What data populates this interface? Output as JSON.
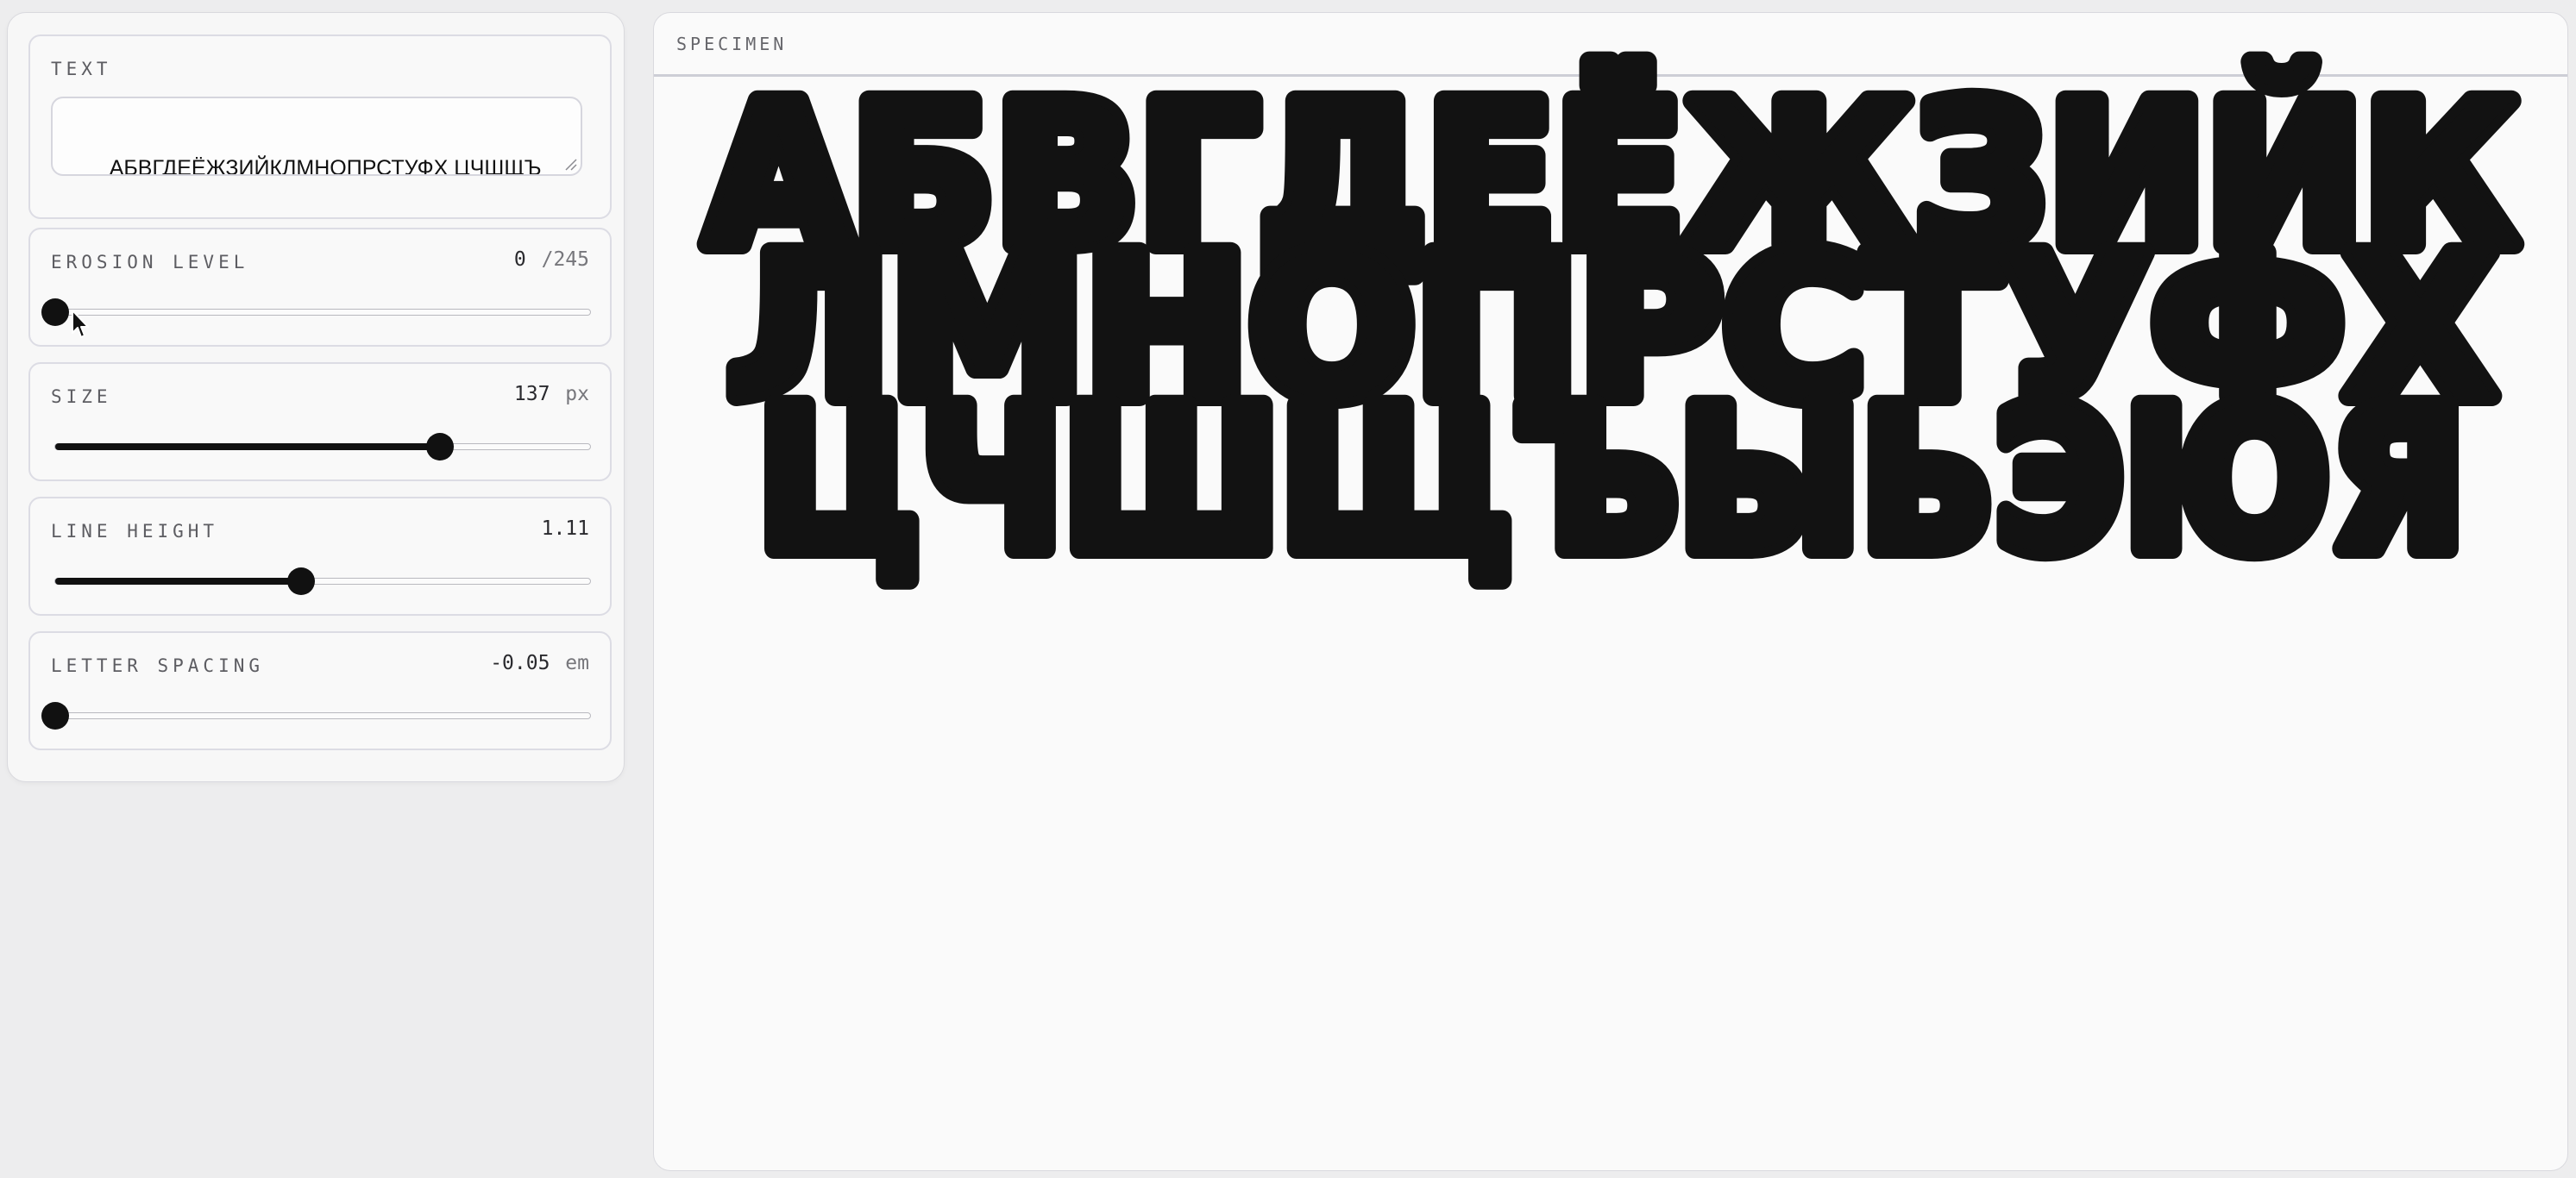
{
  "controls": {
    "text": {
      "label": "TEXT",
      "value": "АБВГДЕЁЖЗИЙКЛМНОПРСТУФХ ЦЧШЩЪЫЬЭЮЯ"
    },
    "erosion": {
      "label": "EROSION LEVEL",
      "value": "0",
      "max_label": "/245",
      "fraction": 0
    },
    "size": {
      "label": "SIZE",
      "value": "137",
      "unit": "px",
      "fraction": 0.72
    },
    "line_height": {
      "label": "LINE HEIGHT",
      "value": "1.11",
      "fraction": 0.46
    },
    "letter_spacing": {
      "label": "LETTER SPACING",
      "value": "-0.05",
      "unit": "em",
      "fraction": 0
    }
  },
  "specimen": {
    "label": "SPECIMEN",
    "lines": [
      "АБВГДЕЁЖЗИЙК",
      "ЛМНОПРСТУФХ",
      "ЦЧШЩЪЫЬЭЮЯ"
    ]
  },
  "colors": {
    "ink": "#121212",
    "panel_bg": "#f7f7f7",
    "page_bg": "#ededee"
  }
}
